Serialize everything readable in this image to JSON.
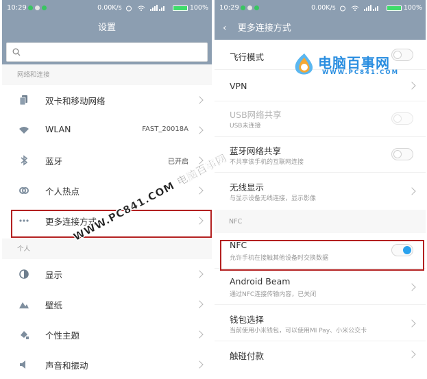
{
  "status_bar": {
    "time": "10:29",
    "speed": "0.00K/s",
    "battery": "100%"
  },
  "left": {
    "title": "设置",
    "search": {
      "placeholder": ""
    },
    "section1": "网络和连接",
    "items": [
      {
        "label": "双卡和移动网络",
        "value": "",
        "icon": "sim-cards-icon"
      },
      {
        "label": "WLAN",
        "value": "FAST_20018A",
        "icon": "wifi-icon"
      },
      {
        "label": "蓝牙",
        "value": "已开启",
        "icon": "bluetooth-icon"
      },
      {
        "label": "个人热点",
        "value": "",
        "icon": "hotspot-icon"
      },
      {
        "label": "更多连接方式",
        "value": "",
        "icon": "more-dots-icon"
      }
    ],
    "section2": "个人",
    "items2": [
      {
        "label": "显示",
        "icon": "display-icon"
      },
      {
        "label": "壁纸",
        "icon": "wallpaper-icon"
      },
      {
        "label": "个性主题",
        "icon": "theme-icon"
      },
      {
        "label": "声音和振动",
        "icon": "sound-icon"
      }
    ]
  },
  "right": {
    "title": "更多连接方式",
    "items": [
      {
        "label": "飞行模式",
        "sub": "",
        "control": "toggle-off"
      },
      {
        "label": "VPN",
        "sub": "",
        "control": "chevron"
      },
      {
        "label": "USB网络共享",
        "sub": "USB未连接",
        "control": "toggle-disabled"
      },
      {
        "label": "蓝牙网络共享",
        "sub": "不共享该手机的互联网连接",
        "control": "toggle-off"
      },
      {
        "label": "无线显示",
        "sub": "与显示设备无线连接，显示影像",
        "control": "chevron"
      }
    ],
    "section_nfc": "NFC",
    "nfc_items": [
      {
        "label": "NFC",
        "sub": "允许手机在接触其他设备时交换数据",
        "control": "toggle-on"
      },
      {
        "label": "Android Beam",
        "sub": "通过NFC连接传输内容，已关闭",
        "control": "chevron"
      },
      {
        "label": "钱包选择",
        "sub": "当前使用小米钱包，可以使用MI Pay、小米公交卡",
        "control": "chevron"
      },
      {
        "label": "触碰付款",
        "sub": "",
        "control": "chevron"
      }
    ]
  },
  "watermark": {
    "diagonal": "WWW.PC841.COM 电脑百事网",
    "brand_name": "电脑百事网",
    "brand_url": "WWW.PC841.COM"
  },
  "colors": {
    "header": "#8c9eb1",
    "toggle_on": "#2aa2ee",
    "highlight": "#b32020"
  }
}
